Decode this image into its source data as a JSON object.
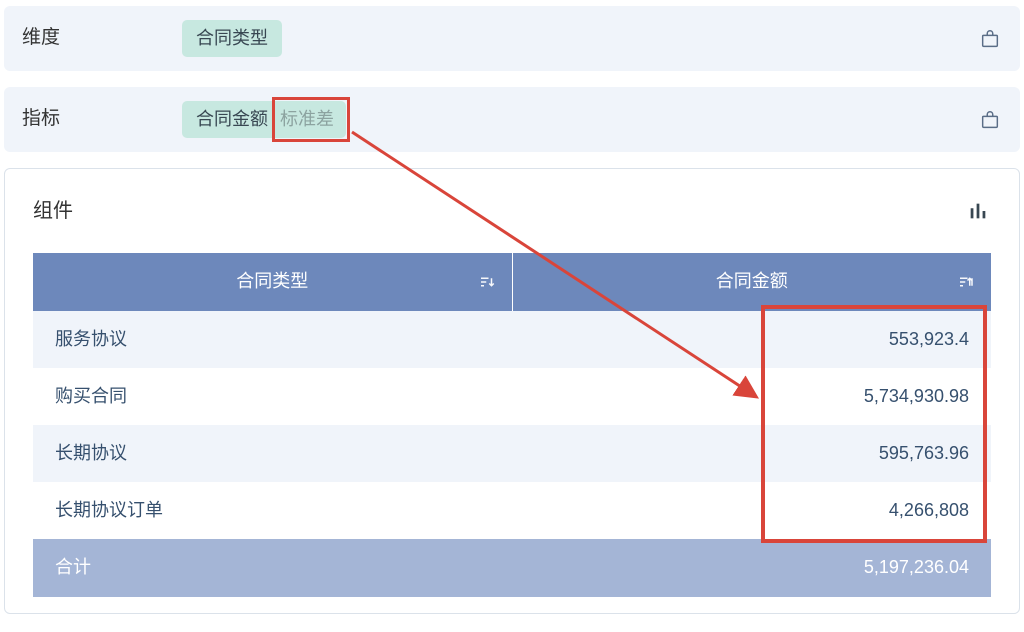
{
  "config": {
    "dimension": {
      "label": "维度",
      "chip": "合同类型"
    },
    "metric": {
      "label": "指标",
      "chip_primary": "合同金额",
      "chip_suffix": "标准差"
    }
  },
  "component": {
    "title": "组件",
    "columns": {
      "col1": "合同类型",
      "col2": "合同金额"
    },
    "rows": [
      {
        "cat": "服务协议",
        "val": "553,923.4"
      },
      {
        "cat": "购买合同",
        "val": "5,734,930.98"
      },
      {
        "cat": "长期协议",
        "val": "595,763.96"
      },
      {
        "cat": "长期协议订单",
        "val": "4,266,808"
      }
    ],
    "footer": {
      "label": "合计",
      "val": "5,197,236.04"
    }
  },
  "icons": {
    "config": "config-icon",
    "chart": "chart-icon",
    "sort": "sort-icon"
  },
  "chart_data": {
    "type": "table",
    "title": "组件",
    "columns": [
      "合同类型",
      "合同金额"
    ],
    "rows": [
      [
        "服务协议",
        553923.4
      ],
      [
        "购买合同",
        5734930.98
      ],
      [
        "长期协议",
        595763.96
      ],
      [
        "长期协议订单",
        4266808
      ]
    ],
    "footer": [
      "合计",
      5197236.04
    ]
  },
  "colors": {
    "header_blue": "#6d88bb",
    "footer_blue": "#a4b5d6",
    "row_alt": "#f0f4fa",
    "chip_bg": "#c7e8e0",
    "annotation": "#d9453a"
  }
}
